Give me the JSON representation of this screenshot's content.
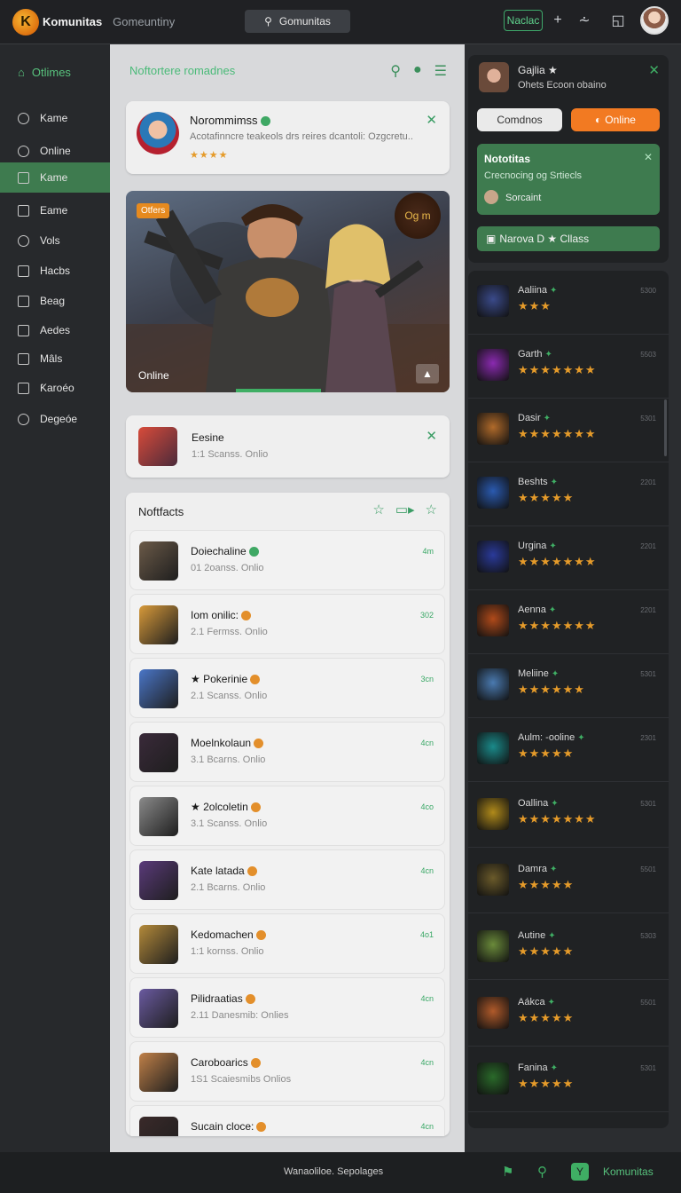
{
  "topbar": {
    "brand": "Komunitas",
    "subtitle": "Gomeuntiny",
    "search_label": "Gomunitas",
    "nac_label": "Naclac"
  },
  "sidebar": {
    "header": "Otlimes",
    "items": [
      {
        "label": "Kame",
        "icon": "clock-icon"
      },
      {
        "label": "Online",
        "icon": "circle-icon"
      },
      {
        "label": "Kame",
        "icon": "grid-icon",
        "active": true
      },
      {
        "label": "Eame",
        "icon": "square-icon"
      },
      {
        "label": "Vols",
        "icon": "circle-icon"
      },
      {
        "label": "Hacbs",
        "icon": "doc-icon"
      },
      {
        "label": "Beag",
        "icon": "square-icon"
      },
      {
        "label": "Aedes",
        "icon": "checkbox-icon"
      },
      {
        "label": "Mâls",
        "icon": "checkbox-icon"
      },
      {
        "label": "Ƙaroéo",
        "icon": "doc-icon"
      },
      {
        "label": "Degeóe",
        "icon": "check-circle-icon"
      }
    ]
  },
  "main": {
    "heading": "Noftortere romadnes",
    "profile": {
      "name": "Norommimss",
      "description": "Acotafinncre teakeols drs reires dcantoli: Ozgcretu..",
      "stars": "★★★★"
    },
    "hero": {
      "tag": "Otfers",
      "badge": "Og m",
      "label": "Online"
    },
    "highlight": {
      "title": "Eesine",
      "subtitle": "1:1 Scanss. Onlio"
    },
    "list_header": "Noftfacts",
    "rows": [
      {
        "title": "Doiechaline",
        "sub": "01 2oanss. Onlio",
        "num": "4m"
      },
      {
        "title": "Iom onilic:",
        "sub": "2.1 Fermss. Onlio",
        "num": "302"
      },
      {
        "title": "★ Pokerinie",
        "sub": "2.1 Scanss. Onlio",
        "num": "3cn"
      },
      {
        "title": "Moelnkolaun",
        "sub": "3.1 Bcarns. Onlio",
        "num": "4cn"
      },
      {
        "title": "★ 2olcoletin",
        "sub": "3.1 Scanss. Onlio",
        "num": "4co"
      },
      {
        "title": "Kate latada",
        "sub": "2.1 Bcarns. Onlio",
        "num": "4cn"
      },
      {
        "title": "Kedomachen",
        "sub": "1:1 kornss. Onlio",
        "num": "4o1"
      },
      {
        "title": "Pilidraatias",
        "sub": "2.11 Danesmib: Onlies",
        "num": "4cn"
      },
      {
        "title": "Caroboarics",
        "sub": "1S1 Scaiesmibs Onlios",
        "num": "4cn"
      },
      {
        "title": "Sucain cloce:",
        "sub": "",
        "num": "4cn"
      }
    ]
  },
  "right": {
    "user": {
      "name": "Gajlia ★",
      "sub": "Ohets Ecoon obaino"
    },
    "btn_friends": "Comdnos",
    "btn_online": "Online",
    "notification": {
      "title": "Nototitas",
      "body": "Crecnocing og Srtiecls",
      "user": "Sorcaint"
    },
    "bar_label": "Narova D ★ Cllass",
    "list": [
      {
        "name": "Aaliina",
        "stars": "★★★",
        "num": "5300"
      },
      {
        "name": "Garth",
        "stars": "★★★★★★★",
        "num": "5503"
      },
      {
        "name": "Dasir",
        "stars": "★★★★★★★",
        "num": "5301"
      },
      {
        "name": "Beshts",
        "stars": "★★★★★",
        "num": "2201"
      },
      {
        "name": "Urgina",
        "stars": "★★★★★★★",
        "num": "2201"
      },
      {
        "name": "Aenna",
        "stars": "★★★★★★★",
        "num": "2201"
      },
      {
        "name": "Meliine",
        "stars": "★★★★★★",
        "num": "5301"
      },
      {
        "name": "Aulm: -ooline",
        "stars": "★★★★★",
        "num": "2301"
      },
      {
        "name": "Oallina",
        "stars": "★★★★★★★",
        "num": "5301"
      },
      {
        "name": "Damra",
        "stars": "★★★★★",
        "num": "5501"
      },
      {
        "name": "Autine",
        "stars": "★★★★★",
        "num": "5303"
      },
      {
        "name": "Aákca",
        "stars": "★★★★★",
        "num": "5501"
      },
      {
        "name": "Fanina",
        "stars": "★★★★★",
        "num": "5301"
      }
    ]
  },
  "bottombar": {
    "text": "Wanaoliloe. Sepolages",
    "brand": "Komunitas"
  },
  "colors": {
    "accent_green": "#3e7b4f",
    "accent_orange": "#f27a22",
    "star": "#e59b2a"
  }
}
